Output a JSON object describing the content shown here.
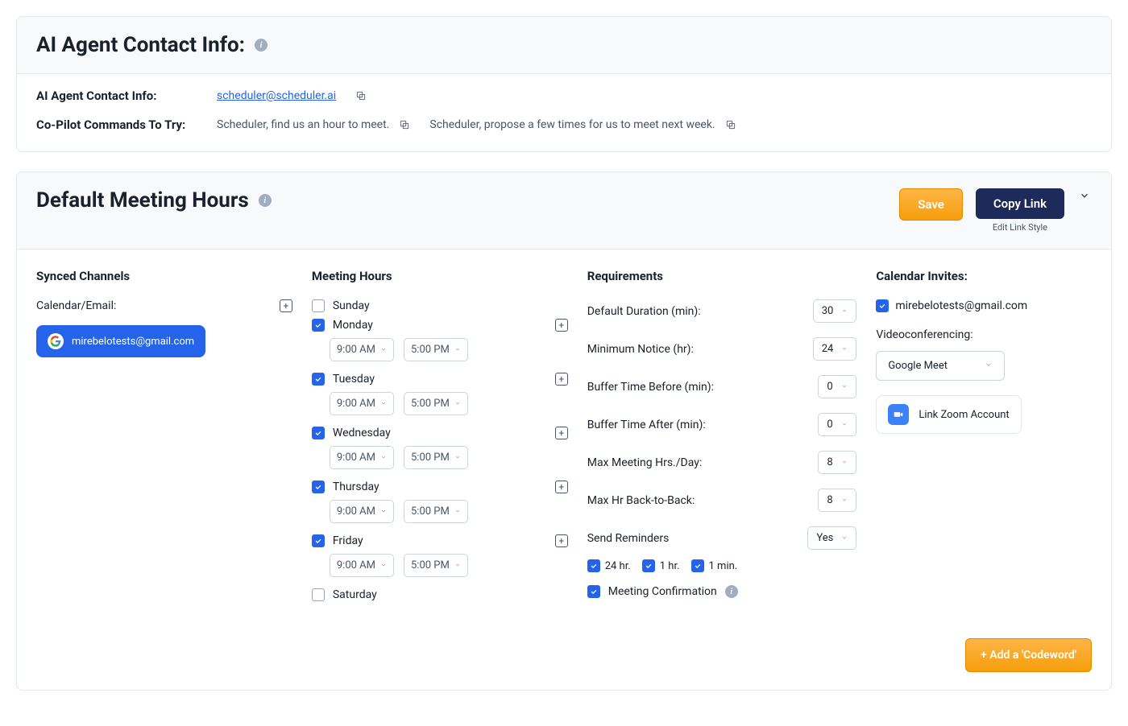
{
  "contactCard": {
    "title": "AI Agent Contact Info:",
    "rowLabel": "AI Agent Contact Info:",
    "email": "scheduler@scheduler.ai",
    "commandsLabel": "Co-Pilot Commands To Try:",
    "command1": "Scheduler, find us an hour to meet.",
    "command2": "Scheduler, propose a few times for us to meet next week."
  },
  "hoursCard": {
    "title": "Default Meeting Hours",
    "saveLabel": "Save",
    "copyLabel": "Copy Link",
    "editLinkLabel": "Edit Link Style"
  },
  "synced": {
    "heading": "Synced Channels",
    "calEmailLabel": "Calendar/Email:",
    "account": "mirebelotests@gmail.com"
  },
  "meetingHours": {
    "heading": "Meeting Hours",
    "days": [
      {
        "name": "Sunday",
        "checked": false,
        "hasTimes": false
      },
      {
        "name": "Monday",
        "checked": true,
        "hasTimes": true,
        "start": "9:00 AM",
        "end": "5:00 PM"
      },
      {
        "name": "Tuesday",
        "checked": true,
        "hasTimes": true,
        "start": "9:00 AM",
        "end": "5:00 PM"
      },
      {
        "name": "Wednesday",
        "checked": true,
        "hasTimes": true,
        "start": "9:00 AM",
        "end": "5:00 PM"
      },
      {
        "name": "Thursday",
        "checked": true,
        "hasTimes": true,
        "start": "9:00 AM",
        "end": "5:00 PM"
      },
      {
        "name": "Friday",
        "checked": true,
        "hasTimes": true,
        "start": "9:00 AM",
        "end": "5:00 PM"
      },
      {
        "name": "Saturday",
        "checked": false,
        "hasTimes": false
      }
    ]
  },
  "requirements": {
    "heading": "Requirements",
    "defaultDurationLabel": "Default Duration (min):",
    "defaultDuration": "30",
    "minNoticeLabel": "Minimum Notice (hr):",
    "minNotice": "24",
    "bufferBeforeLabel": "Buffer Time Before (min):",
    "bufferBefore": "0",
    "bufferAfterLabel": "Buffer Time After (min):",
    "bufferAfter": "0",
    "maxPerDayLabel": "Max Meeting Hrs./Day:",
    "maxPerDay": "8",
    "maxBackToBackLabel": "Max Hr Back-to-Back:",
    "maxBackToBack": "8",
    "sendRemindersLabel": "Send Reminders",
    "sendReminders": "Yes",
    "reminder24": "24 hr.",
    "reminder1h": "1 hr.",
    "reminder1m": "1 min.",
    "confirmationLabel": "Meeting Confirmation"
  },
  "calendarInvites": {
    "heading": "Calendar Invites:",
    "account": "mirebelotests@gmail.com",
    "videoLabel": "Videoconferencing:",
    "videoProvider": "Google Meet",
    "zoomLabel": "Link Zoom Account"
  },
  "footer": {
    "addCodeword": "+ Add a 'Codeword'"
  }
}
